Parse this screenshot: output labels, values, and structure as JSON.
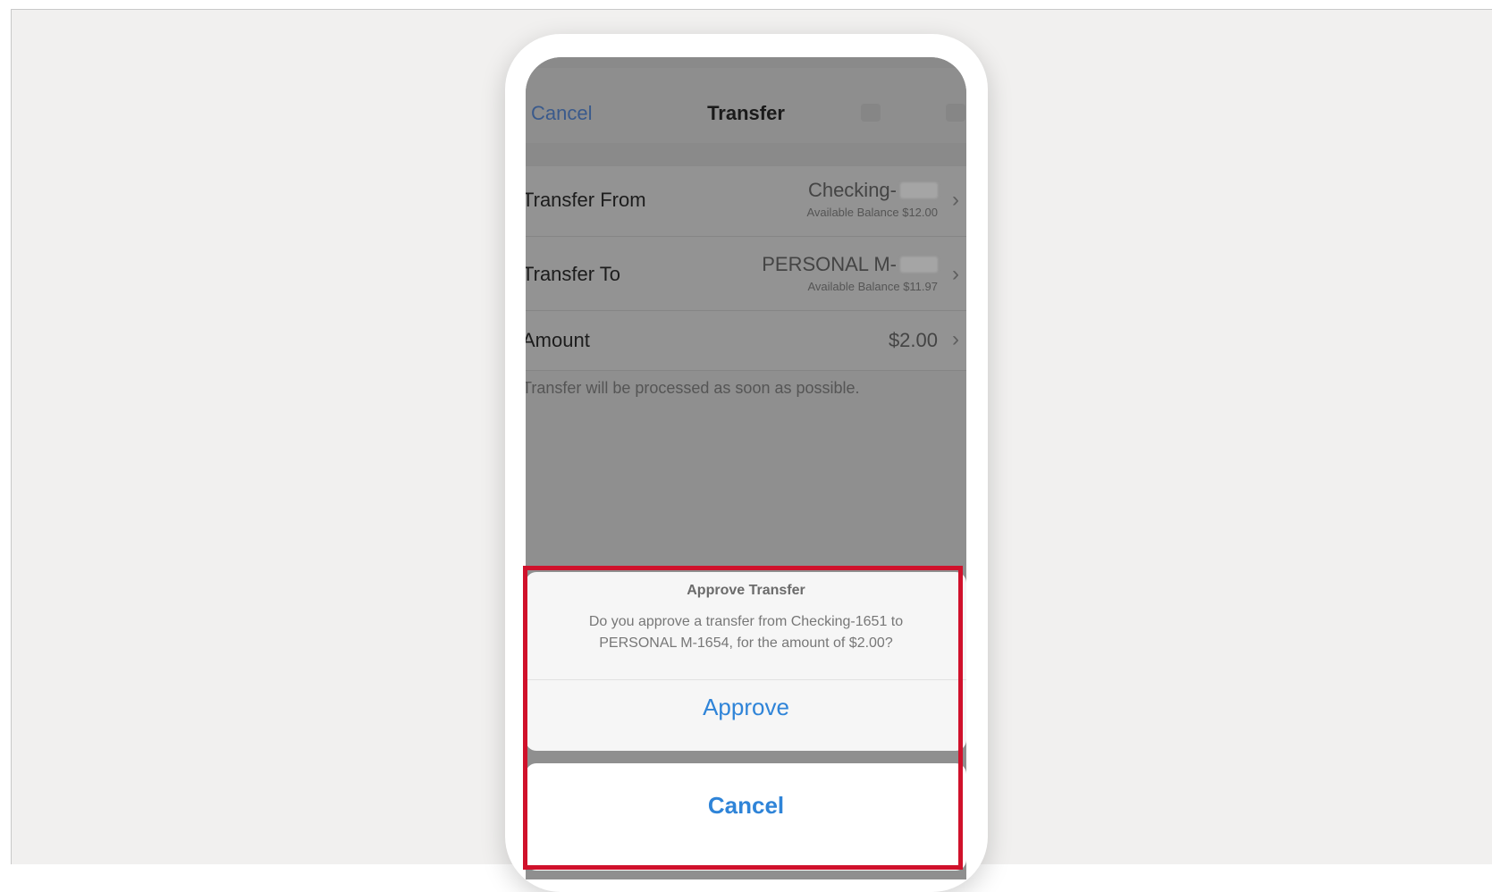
{
  "nav": {
    "cancel_label": "Cancel",
    "title": "Transfer"
  },
  "rows": [
    {
      "label": "Transfer From",
      "value": "Checking-",
      "sub": "Available Balance $12.00"
    },
    {
      "label": "Transfer To",
      "value": "PERSONAL M-",
      "sub": "Available Balance $11.97"
    },
    {
      "label": "Amount",
      "value": "$2.00",
      "sub": ""
    }
  ],
  "footnote": "Transfer will be processed as soon as possible.",
  "dialog": {
    "title": "Approve Transfer",
    "message_line1": "Do you approve a transfer from Checking-1651 to",
    "message_line2": "PERSONAL M-1654, for the amount of $2.00?",
    "approve_label": "Approve",
    "cancel_label": "Cancel"
  },
  "colors": {
    "accent": "#2f84d8",
    "highlight": "#d0112b"
  }
}
